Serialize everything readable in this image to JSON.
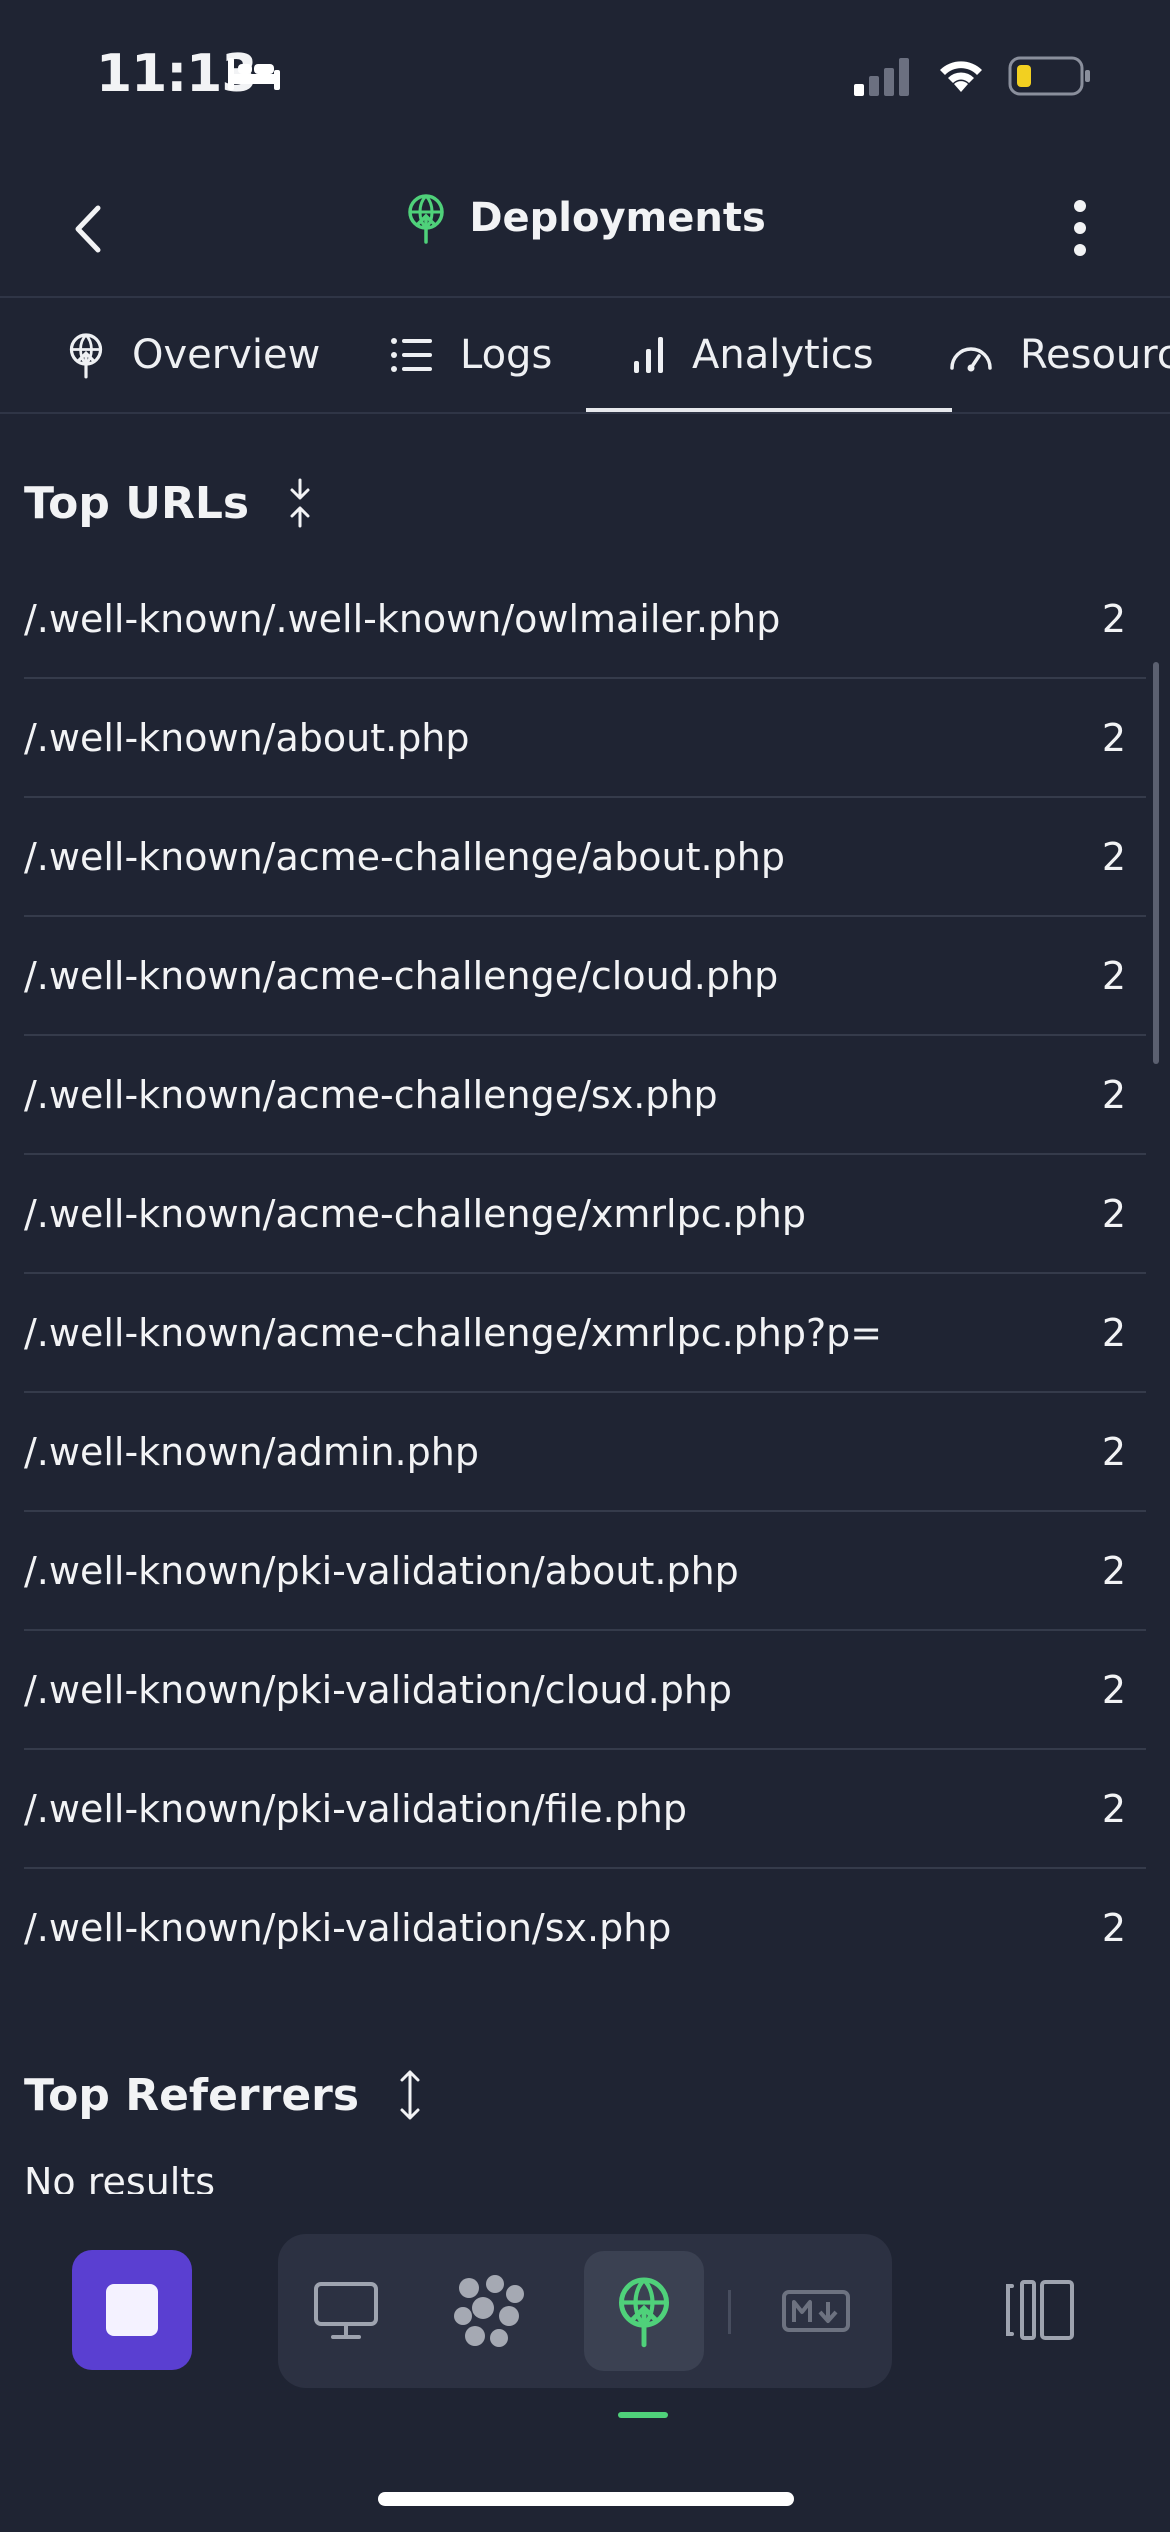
{
  "status_bar": {
    "time": "11:13"
  },
  "nav": {
    "title": "Deployments"
  },
  "tabs": [
    {
      "label": "Overview",
      "icon": "deploy-icon"
    },
    {
      "label": "Logs",
      "icon": "list-icon"
    },
    {
      "label": "Analytics",
      "icon": "bar-chart-icon",
      "active": true
    },
    {
      "label": "Resources",
      "icon": "gauge-icon"
    }
  ],
  "top_urls": {
    "title": "Top URLs",
    "rows": [
      {
        "url": "/.well-known/.well-known/owlmailer.php",
        "count": "2"
      },
      {
        "url": "/.well-known/about.php",
        "count": "2"
      },
      {
        "url": "/.well-known/acme-challenge/about.php",
        "count": "2"
      },
      {
        "url": "/.well-known/acme-challenge/cloud.php",
        "count": "2"
      },
      {
        "url": "/.well-known/acme-challenge/sx.php",
        "count": "2"
      },
      {
        "url": "/.well-known/acme-challenge/xmrlpc.php",
        "count": "2"
      },
      {
        "url": "/.well-known/acme-challenge/xmrlpc.php?p=",
        "count": "2"
      },
      {
        "url": "/.well-known/admin.php",
        "count": "2"
      },
      {
        "url": "/.well-known/pki-validation/about.php",
        "count": "2"
      },
      {
        "url": "/.well-known/pki-validation/cloud.php",
        "count": "2"
      },
      {
        "url": "/.well-known/pki-validation/file.php",
        "count": "2"
      },
      {
        "url": "/.well-known/pki-validation/sx.php",
        "count": "2"
      }
    ]
  },
  "top_referrers": {
    "title": "Top Referrers",
    "empty_text": "No results"
  },
  "colors": {
    "accent_green": "#4fd17a",
    "stop_purple": "#5a3fd1",
    "background": "#1f2433"
  }
}
